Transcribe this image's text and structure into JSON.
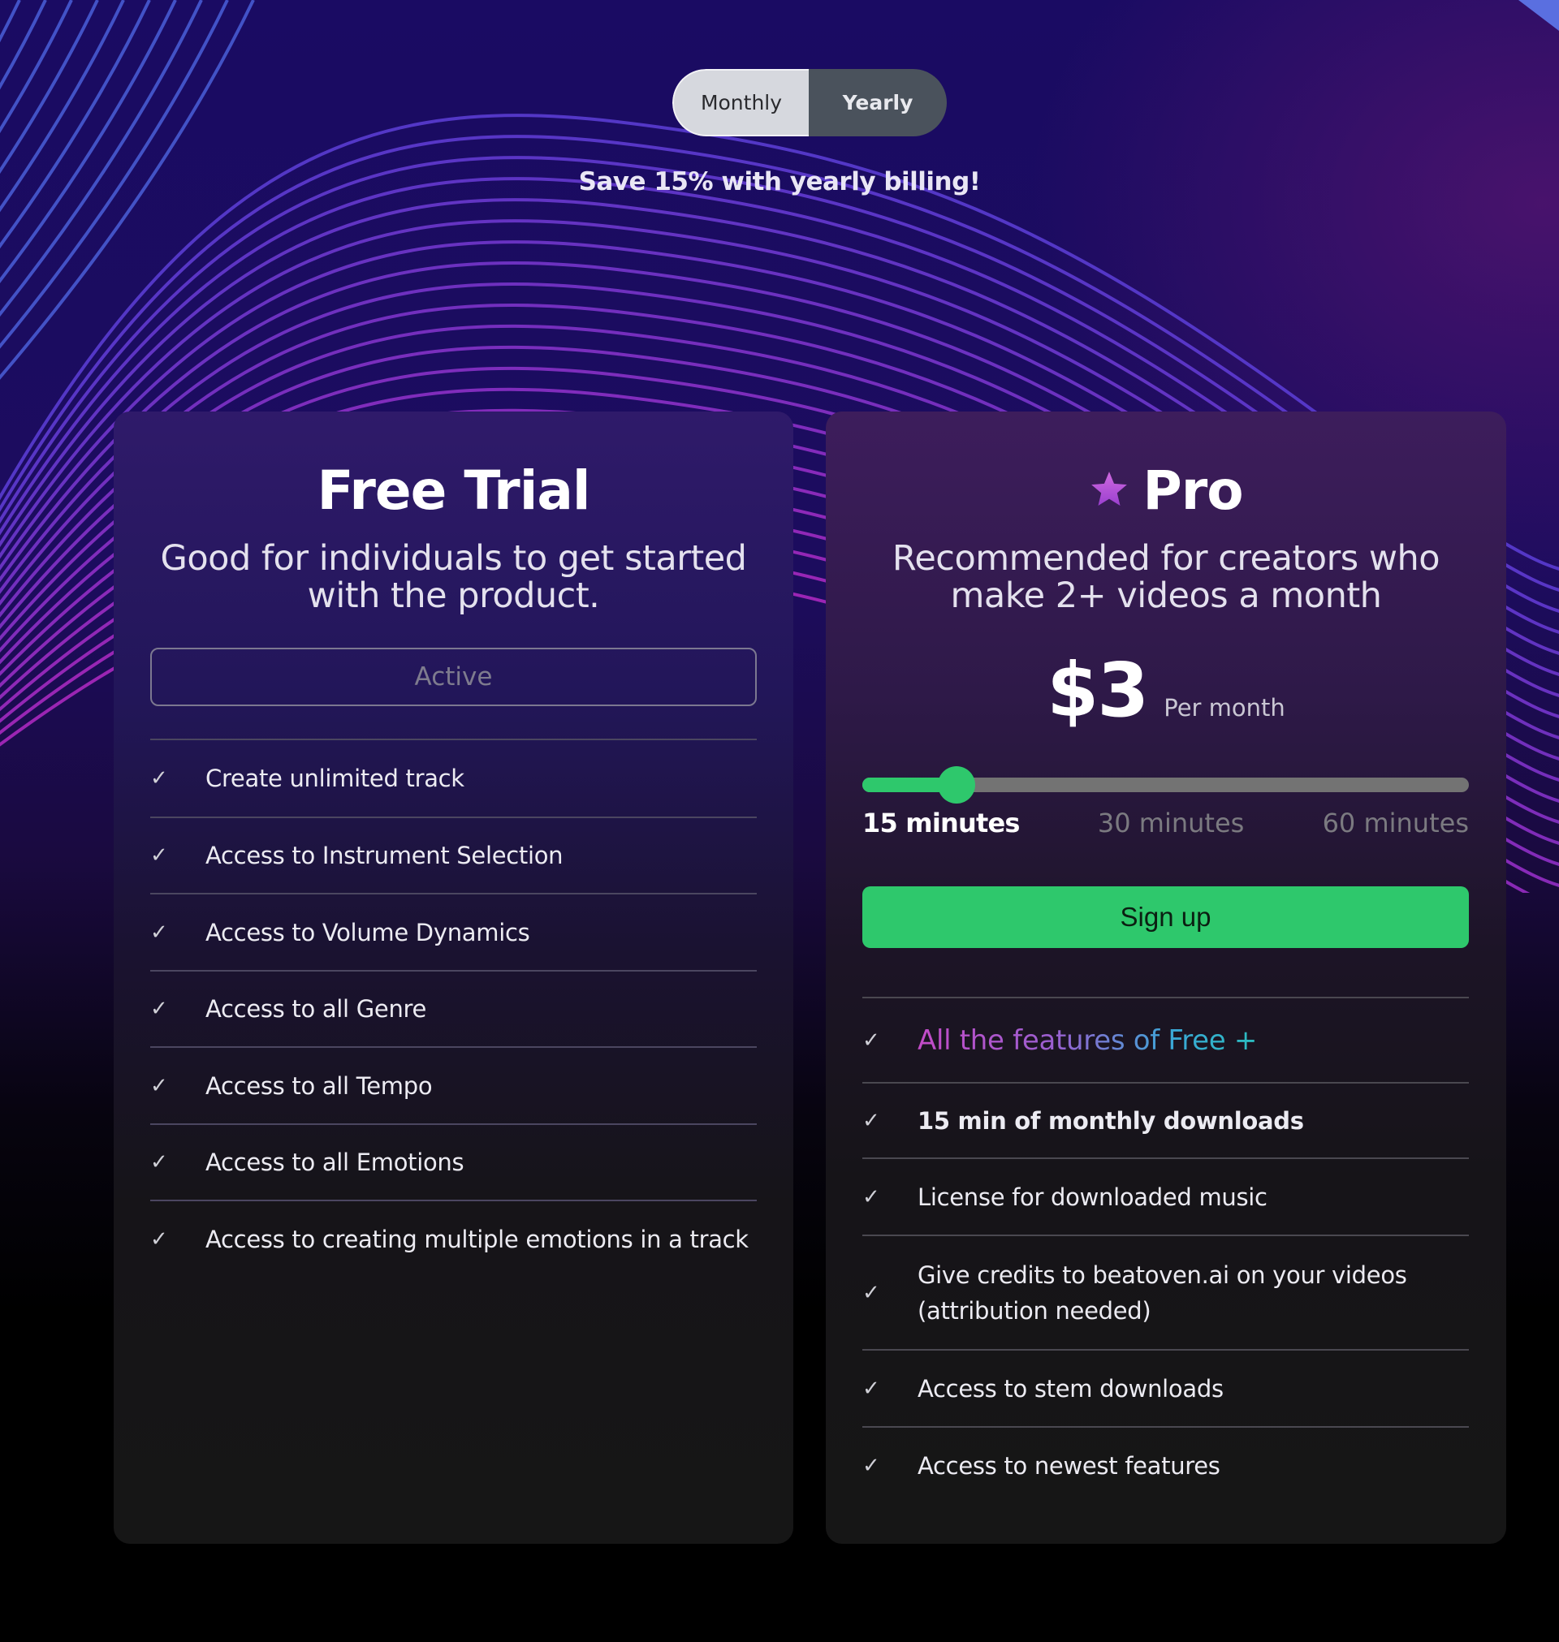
{
  "billing_toggle": {
    "options": [
      "Monthly",
      "Yearly"
    ],
    "selected": "Monthly"
  },
  "save_note": "Save 15% with yearly billing!",
  "plans": {
    "free": {
      "title": "Free Trial",
      "description_line1": "Good for individuals to get started",
      "description_line2": "with the product.",
      "button_label": "Active",
      "features": [
        "Create unlimited track",
        "Access to Instrument Selection",
        "Access to Volume Dynamics",
        "Access to all Genre",
        "Access to all Tempo",
        "Access to all Emotions",
        "Access to creating multiple emotions in a track"
      ]
    },
    "pro": {
      "icon": "star-icon",
      "title": "Pro",
      "description_line1": "Recommended for creators who",
      "description_line2": "make 2+ videos a month",
      "price": "$3",
      "price_period": "Per month",
      "slider": {
        "options": [
          "15 minutes",
          "30 minutes",
          "60 minutes"
        ],
        "selected": "15 minutes",
        "fill_fraction": 0.155
      },
      "button_label": "Sign up",
      "features": [
        "All the features of Free +",
        "15 min of monthly downloads",
        "License for downloaded music",
        "Give credits to beatoven.ai on your videos (attribution needed)",
        "Access to stem downloads",
        "Access to newest features"
      ]
    }
  },
  "colors": {
    "accent_green": "#2ec86c",
    "star_purple": "#b24fd6",
    "gradient_start": "#c34bc7",
    "gradient_end": "#2bbcbf"
  }
}
